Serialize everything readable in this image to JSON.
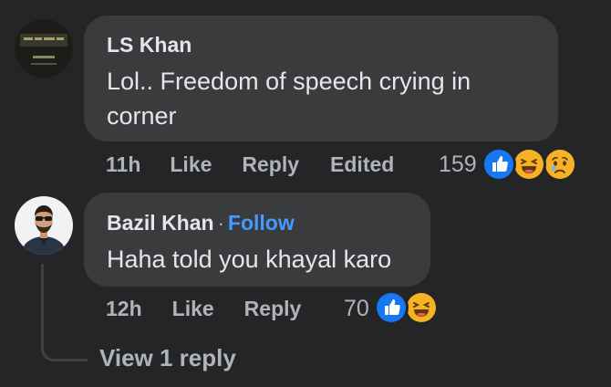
{
  "comments": [
    {
      "author": "LS Khan",
      "text_line1": "Lol.. Freedom of speech crying in",
      "text_line2": "corner",
      "time": "11h",
      "like_label": "Like",
      "reply_label": "Reply",
      "edited_label": "Edited",
      "reaction_count": "159",
      "reactions": [
        "like-icon",
        "haha-icon",
        "sad-icon"
      ]
    },
    {
      "author": "Bazil Khan",
      "separator": "·",
      "follow_label": "Follow",
      "text": "Haha told you khayal karo",
      "time": "12h",
      "like_label": "Like",
      "reply_label": "Reply",
      "reaction_count": "70",
      "reactions": [
        "like-icon",
        "haha-icon"
      ],
      "view_replies_label": "View 1 reply"
    }
  ],
  "colors": {
    "background": "#242526",
    "bubble": "#3a3b3c",
    "primary_text": "#e4e6eb",
    "secondary_text": "#b0b3b8",
    "accent": "#4599ff",
    "like_blue": "#1877f2",
    "emoji_yellow": "#f7b125"
  }
}
